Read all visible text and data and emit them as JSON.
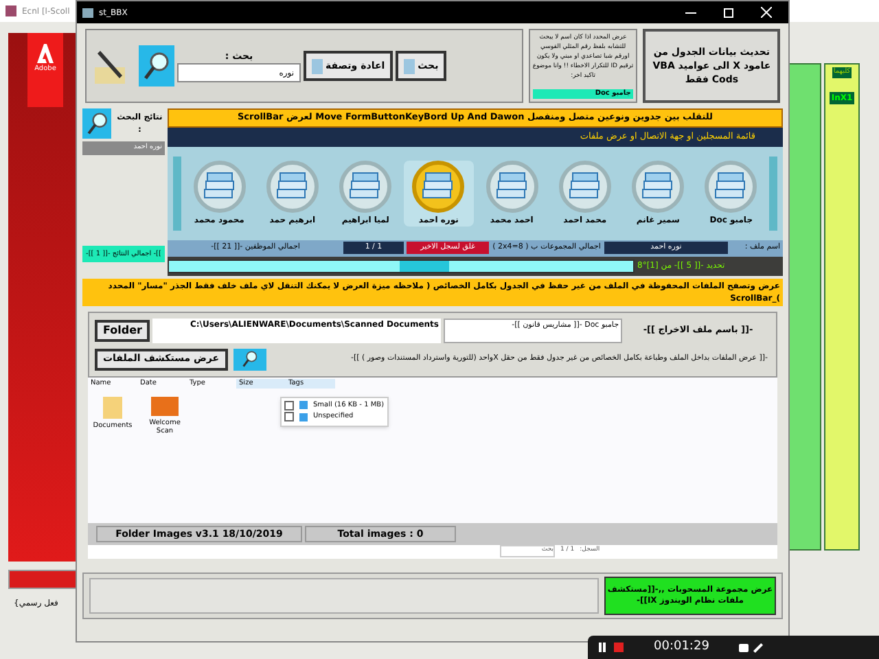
{
  "background_window": {
    "title": "Ecnl [l-Scoll",
    "logo": "Adobe",
    "side_labels": [
      "كلبهما",
      "InX1"
    ],
    "bottom_label": "فعل رسمي}"
  },
  "window": {
    "title": "st_BBX"
  },
  "search_panel": {
    "label": "بحث :",
    "value": "نوره",
    "buttons": [
      "بحث",
      "اعادة وتصفة"
    ],
    "note": "عرض المحدد اذا كان اسم لا يبحث للتشابه بلفظ رقم المثلي القوسي اورقم شبا تصاعدي او مبني ولا يكون ترقيم ID للتكرار الاخطاء !! وانا موضوع تاكيد اخر:",
    "selected_value": "جامبو Doc",
    "update_button": "تحديث بيانات الجدول من عامود X الى عواميد VBA Cods فقط"
  },
  "results": {
    "label": "نتائج البحث :",
    "value": "نوره احمد",
    "total": "]]- اجمالي النتائج -[[ 1 ]]-"
  },
  "banner": "للتقلب بين جدوين ونوعين متصل ومنفصل Move   FormButtonKeyBord  Up And Dawon لعرض ScrollBar",
  "list_header": "قائمة المسجلين او جهة الاتصال او عرض ملفات",
  "contacts": [
    {
      "name": "جامبو Doc",
      "selected": false
    },
    {
      "name": "سمير غانم",
      "selected": false
    },
    {
      "name": "محمد احمد",
      "selected": false
    },
    {
      "name": "احمد محمد",
      "selected": false
    },
    {
      "name": "نوره احمد",
      "selected": true
    },
    {
      "name": "لميا ابراهيم",
      "selected": false
    },
    {
      "name": "ابرهيم حمد",
      "selected": false
    },
    {
      "name": "محمود محمد",
      "selected": false
    }
  ],
  "info_row": {
    "file_label": "اسم ملف :",
    "file_value": "نوره احمد",
    "groups": "اجمالي المجموعات ب ( 8=2x4 )",
    "close_last": "غلق لسجل الاخير",
    "page": "1 / 1",
    "employees": "اجمالي الموظفين -[[ 21 ]]-"
  },
  "scroll": {
    "level": 0.55,
    "selection": "تحديد -[[ 5 ]]- من [1]°8"
  },
  "files_banner": "عرض وتصفح الملفات المحفوظة في الملف من غير حفظ في الجدول بكامل الخصائص ( ملاحظه ميزة العرض لا يمكنك التنقل لاي ملف خلف فقط الجذر \"مسار\" المحدد )_ScrollBar",
  "folder": {
    "button": "Folder",
    "path": "C:\\Users\\ALIENWARE\\Documents\\Scanned Documents",
    "output_value": "جامبو Doc -[[ مشاريس قانون ]]-",
    "output_label": "-[[ باسم ملف الاخراج ]]-",
    "explorer_button": "عرض مستكشف الملفات",
    "explorer_note": "-[[ عرض الملفات بداخل الملف وطباعة بكامل الخصائص من غير جدول فقط من حقل Xواحد (للتورية واسترداد المستندات وصور ) ]]-"
  },
  "explorer": {
    "columns": {
      "name": {
        "label": "Name",
        "selected": false
      },
      "date": {
        "label": "Date",
        "selected": false
      },
      "type": {
        "label": "Type",
        "selected": false
      },
      "size": {
        "label": "Size",
        "selected": true
      },
      "tags": {
        "label": "Tags",
        "selected": true
      }
    },
    "items": {
      "folder": {
        "name": "Documents"
      },
      "image": {
        "name": "Welcome Scan"
      }
    },
    "filter_menu": [
      {
        "label": "Small (16 KB - 1 MB)",
        "checked": false
      },
      {
        "label": "Unspecified",
        "checked": false
      }
    ]
  },
  "status_bar": {
    "version": "Folder Images v3.1  18/10/2019",
    "total": "Total images : 0"
  },
  "record_nav": {
    "label": "السجل:",
    "position": "1 / 1",
    "search": "بحث"
  },
  "bottom_button": "عرض مجموعة المسحوبات ,,-[[مستكشف ملفات نظام الويندوز IX]]-",
  "recorder": {
    "time": "00:01:29"
  }
}
